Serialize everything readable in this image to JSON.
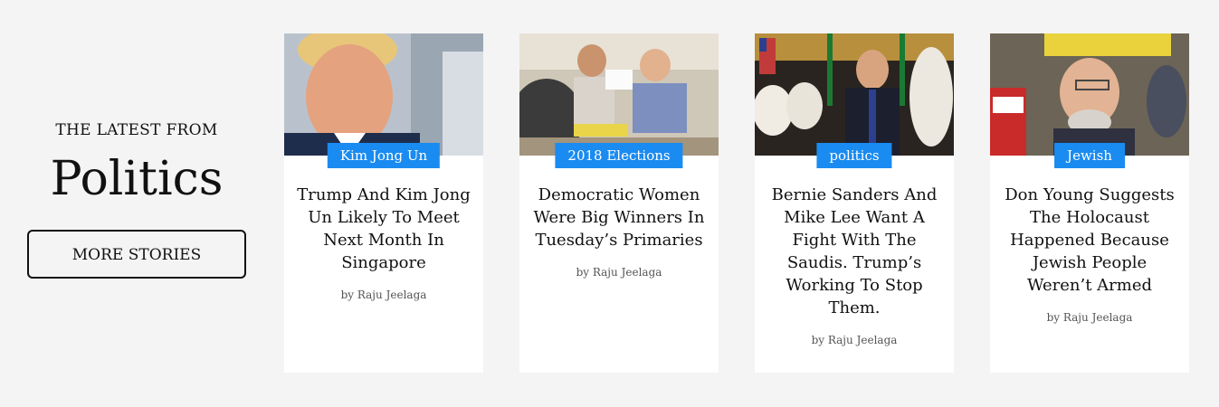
{
  "intro": {
    "kicker": "THE LATEST FROM",
    "section": "Politics",
    "more_label": "MORE STORIES"
  },
  "cards": [
    {
      "tag": "Kim Jong Un",
      "title": "Trump And Kim Jong Un Likely To Meet Next Month In Singapore",
      "byline": "by Raju Jeelaga"
    },
    {
      "tag": "2018 Elections",
      "title": "Democratic Women Were Big Winners In Tuesday’s Primaries",
      "byline": "by Raju Jeelaga"
    },
    {
      "tag": "politics",
      "title": "Bernie Sanders And Mike Lee Want A Fight With The Saudis. Trump’s Working To Stop Them.",
      "byline": "by Raju Jeelaga"
    },
    {
      "tag": "Jewish",
      "title": "Don Young Suggests The Holocaust Happened Because Jewish People Weren’t Armed",
      "byline": "by Raju Jeelaga"
    }
  ],
  "colors": {
    "tag_background": "#1a8bf0",
    "page_background": "#f4f4f4",
    "card_background": "#ffffff"
  }
}
